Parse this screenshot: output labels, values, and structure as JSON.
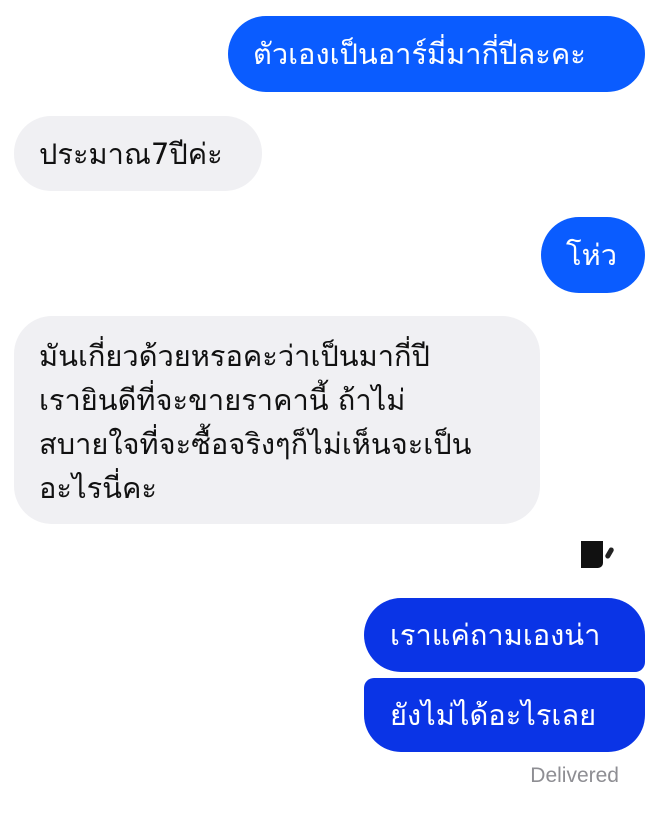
{
  "thread": {
    "messages": [
      {
        "from": "me",
        "text": "ตัวเองเป็นอาร์มี่มากี่ปีละคะ"
      },
      {
        "from": "them",
        "text": "ประมาณ7ปีค่ะ"
      },
      {
        "from": "me",
        "text": "โห่ว"
      },
      {
        "from": "them",
        "lines": [
          "มันเกี่ยวด้วยหรอคะว่าเป็นมากี่ปี",
          "เรายินดีที่จะขายราคานี้ ถ้าไม่",
          "สบายใจที่จะซื้อจริงๆก็ไม่เห็นจะเป็น",
          "อะไรนี่คะ"
        ]
      },
      {
        "from": "me",
        "text": "เราแค่ถามเองน่า"
      },
      {
        "from": "me",
        "text": "ยังไม่ได้อะไรเลย"
      }
    ],
    "reaction_icon": "reaction-icon",
    "delivery_status": "Delivered"
  },
  "colors": {
    "sent_bubble": "#0a5cff",
    "sent_bubble_deep": "#0a34e6",
    "received_bubble": "#f0f0f3",
    "status_text": "#8e8e93"
  }
}
